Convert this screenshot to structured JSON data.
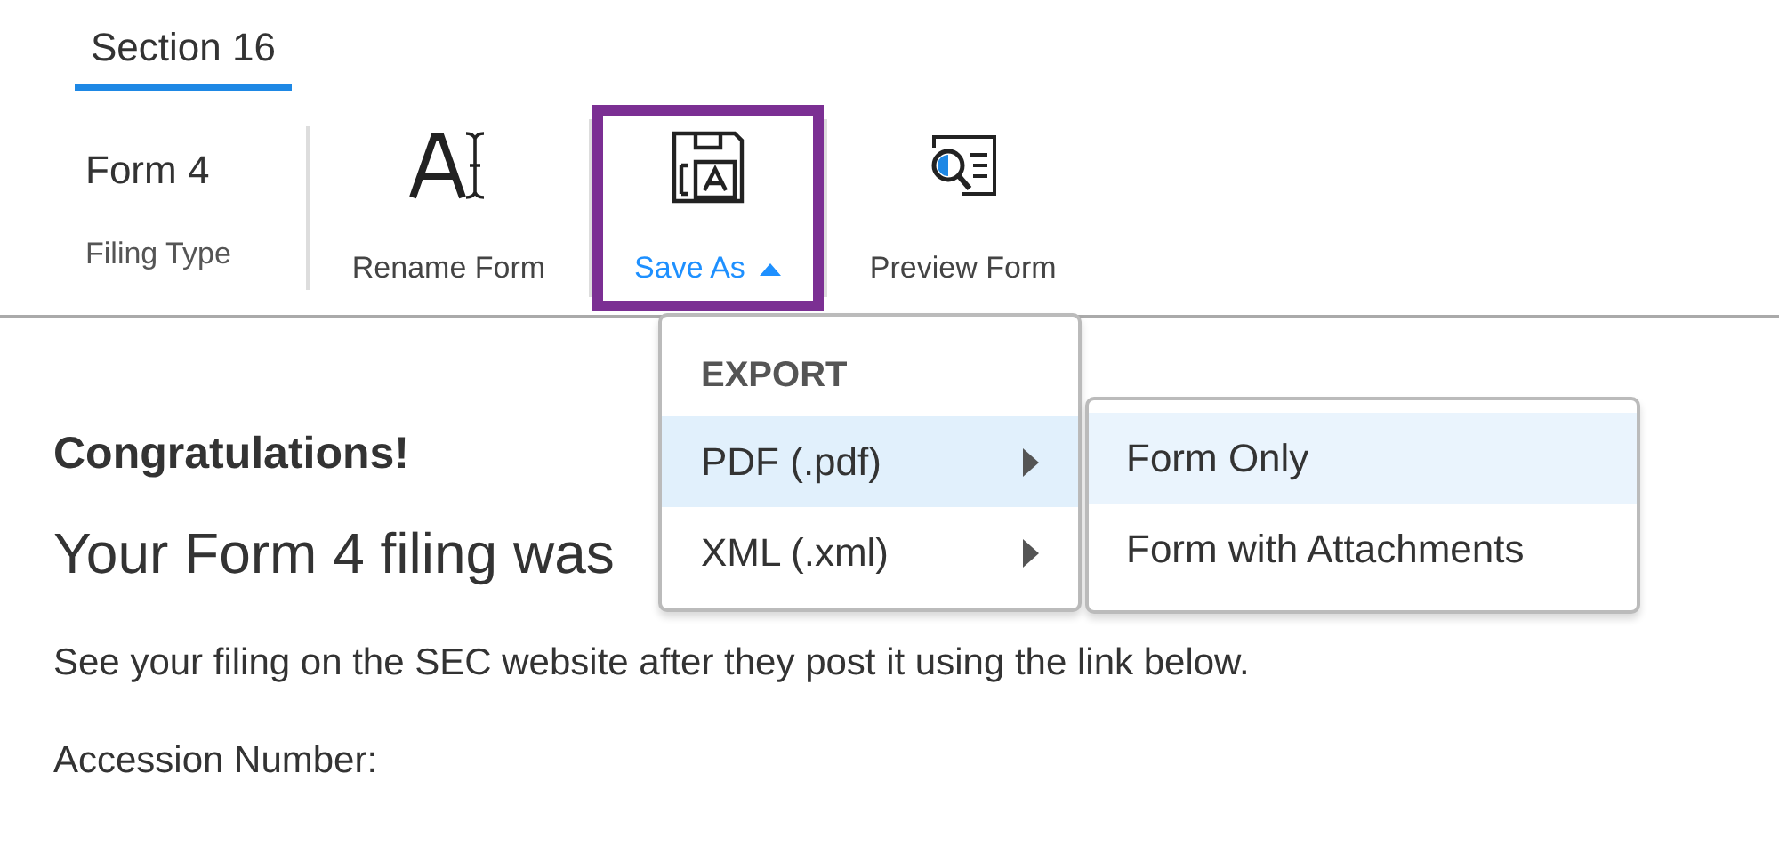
{
  "tab": {
    "label": "Section 16",
    "selected": true
  },
  "filing": {
    "value": "Form 4",
    "label": "Filing Type"
  },
  "tools": [
    {
      "kind": "rename",
      "label": "Rename Form",
      "highlighted": false,
      "open": false
    },
    {
      "kind": "save",
      "label": "Save As",
      "highlighted": true,
      "open": true
    },
    {
      "kind": "preview",
      "label": "Preview Form",
      "highlighted": false,
      "open": false
    }
  ],
  "menu": {
    "header": "EXPORT",
    "items": [
      {
        "label": "PDF (.pdf)",
        "selected": true,
        "submenu": true
      },
      {
        "label": "XML (.xml)",
        "selected": false,
        "submenu": true
      }
    ]
  },
  "submenu": {
    "items": [
      {
        "label": "Form Only",
        "selected": true
      },
      {
        "label": "Form with Attachments",
        "selected": false
      }
    ]
  },
  "content": {
    "heading": "Congratulations!",
    "subheading": "Your Form 4 filing was",
    "note": "See your filing on the SEC website after they post it using the link below.",
    "field_label": "Accession Number:"
  }
}
